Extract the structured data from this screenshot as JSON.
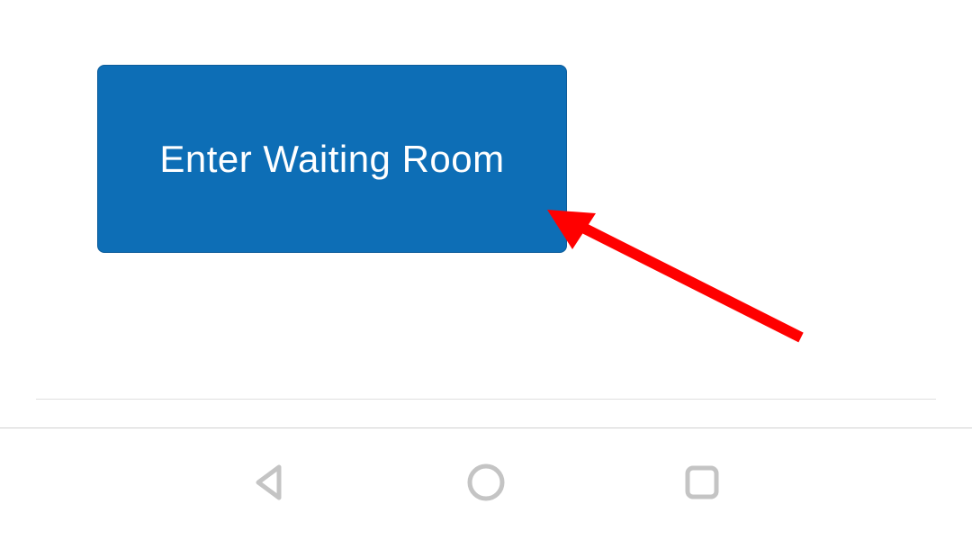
{
  "button": {
    "enter_label": "Enter Waiting Room"
  },
  "nav": {
    "back": "back-icon",
    "home": "home-icon",
    "recent": "recent-icon"
  },
  "annotation": {
    "arrow_color": "#ff0000"
  }
}
